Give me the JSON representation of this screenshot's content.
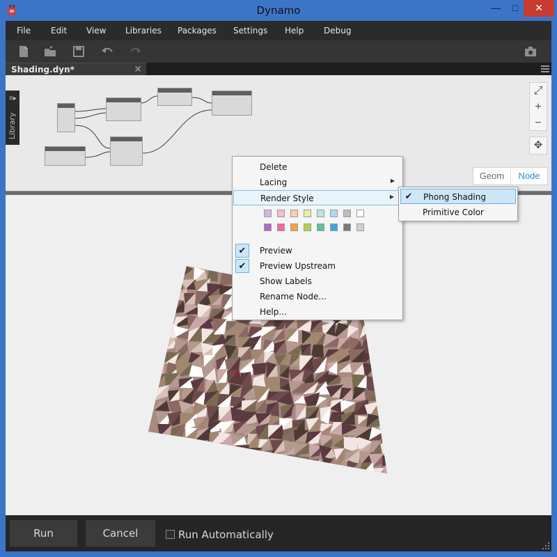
{
  "window": {
    "title": "Dynamo",
    "minimize_glyph": "—",
    "maximize_glyph": "□",
    "close_glyph": "✕"
  },
  "menu": {
    "items": [
      "File",
      "Edit",
      "View",
      "Libraries",
      "Packages",
      "Settings",
      "Help",
      "Debug"
    ]
  },
  "toolbar": {
    "icons": [
      "new-file-icon",
      "open-file-icon",
      "save-icon",
      "undo-icon",
      "redo-icon",
      "camera-icon"
    ]
  },
  "tab": {
    "label": "Shading.dyn*",
    "close_glyph": "✕"
  },
  "library": {
    "label": "Library",
    "arrow": "≡▸"
  },
  "nav": {
    "zoom_fit_glyph": "⤢",
    "zoom_in_glyph": "+",
    "zoom_out_glyph": "−",
    "pan_glyph": "✥"
  },
  "view_toggle": {
    "geom": "Geom",
    "node": "Node",
    "active": "Node"
  },
  "context_menu": {
    "delete": "Delete",
    "lacing": "Lacing",
    "render_style": "Render Style",
    "preview": "Preview",
    "preview_upstream": "Preview Upstream",
    "show_labels": "Show Labels",
    "rename_node": "Rename Node...",
    "help": "Help...",
    "submenu_arrow": "▶",
    "check_glyph": "✔",
    "swatches_row1": [
      "#d8b4e2",
      "#f7b9d4",
      "#f9cfa3",
      "#e6f0a6",
      "#b7ead9",
      "#a9dcf1",
      "#bdbdbd",
      "#ffffff"
    ],
    "swatches_row2": [
      "#b06ac2",
      "#ef6aa0",
      "#f5a33c",
      "#b8cf55",
      "#5cbf9e",
      "#3aa6e2",
      "#7a7a7a",
      "#d0d0d0"
    ]
  },
  "render_style_submenu": {
    "phong": "Phong Shading",
    "primitive": "Primitive Color",
    "selected": "Phong Shading",
    "check_glyph": "✔"
  },
  "bottom": {
    "run": "Run",
    "cancel": "Cancel",
    "run_automatically": "Run Automatically",
    "run_automatically_checked": false
  },
  "colors": {
    "accent": "#2f8fd8",
    "title_bar": "#3c74c8",
    "close_button": "#c73c30",
    "workspace_bg": "#efefef",
    "menu_highlight": "#cde6f7"
  }
}
